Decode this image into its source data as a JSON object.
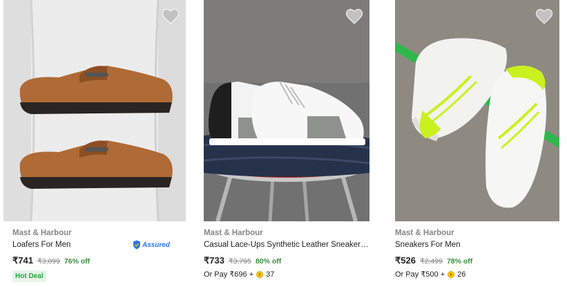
{
  "products": [
    {
      "brand": "Mast & Harbour",
      "title": "Loafers For Men",
      "assured_label": "Assured",
      "price": "₹741",
      "mrp": "₹3,099",
      "discount": "76% off",
      "badge": "Hot Deal"
    },
    {
      "brand": "Mast & Harbour",
      "title": "Casual Lace-Ups Synthetic Leather Sneakers...",
      "price": "₹733",
      "mrp": "₹3,795",
      "discount": "80% off",
      "pay_text": "Or Pay ₹696 +",
      "coins": "37"
    },
    {
      "brand": "Mast & Harbour",
      "title": "Sneakers For Men",
      "price": "₹526",
      "mrp": "₹2,499",
      "discount": "78% off",
      "pay_text": "Or Pay ₹500 +",
      "coins": "26"
    }
  ],
  "colors": {
    "accent": "#2874f0",
    "discount_green": "#388e3c",
    "muted_text": "#878787",
    "wishlist_heart": "#c2c2c2",
    "coin_gold": "#f9c700"
  },
  "icons": [
    "heart-icon",
    "assured-shield-icon",
    "supercoin-icon"
  ]
}
